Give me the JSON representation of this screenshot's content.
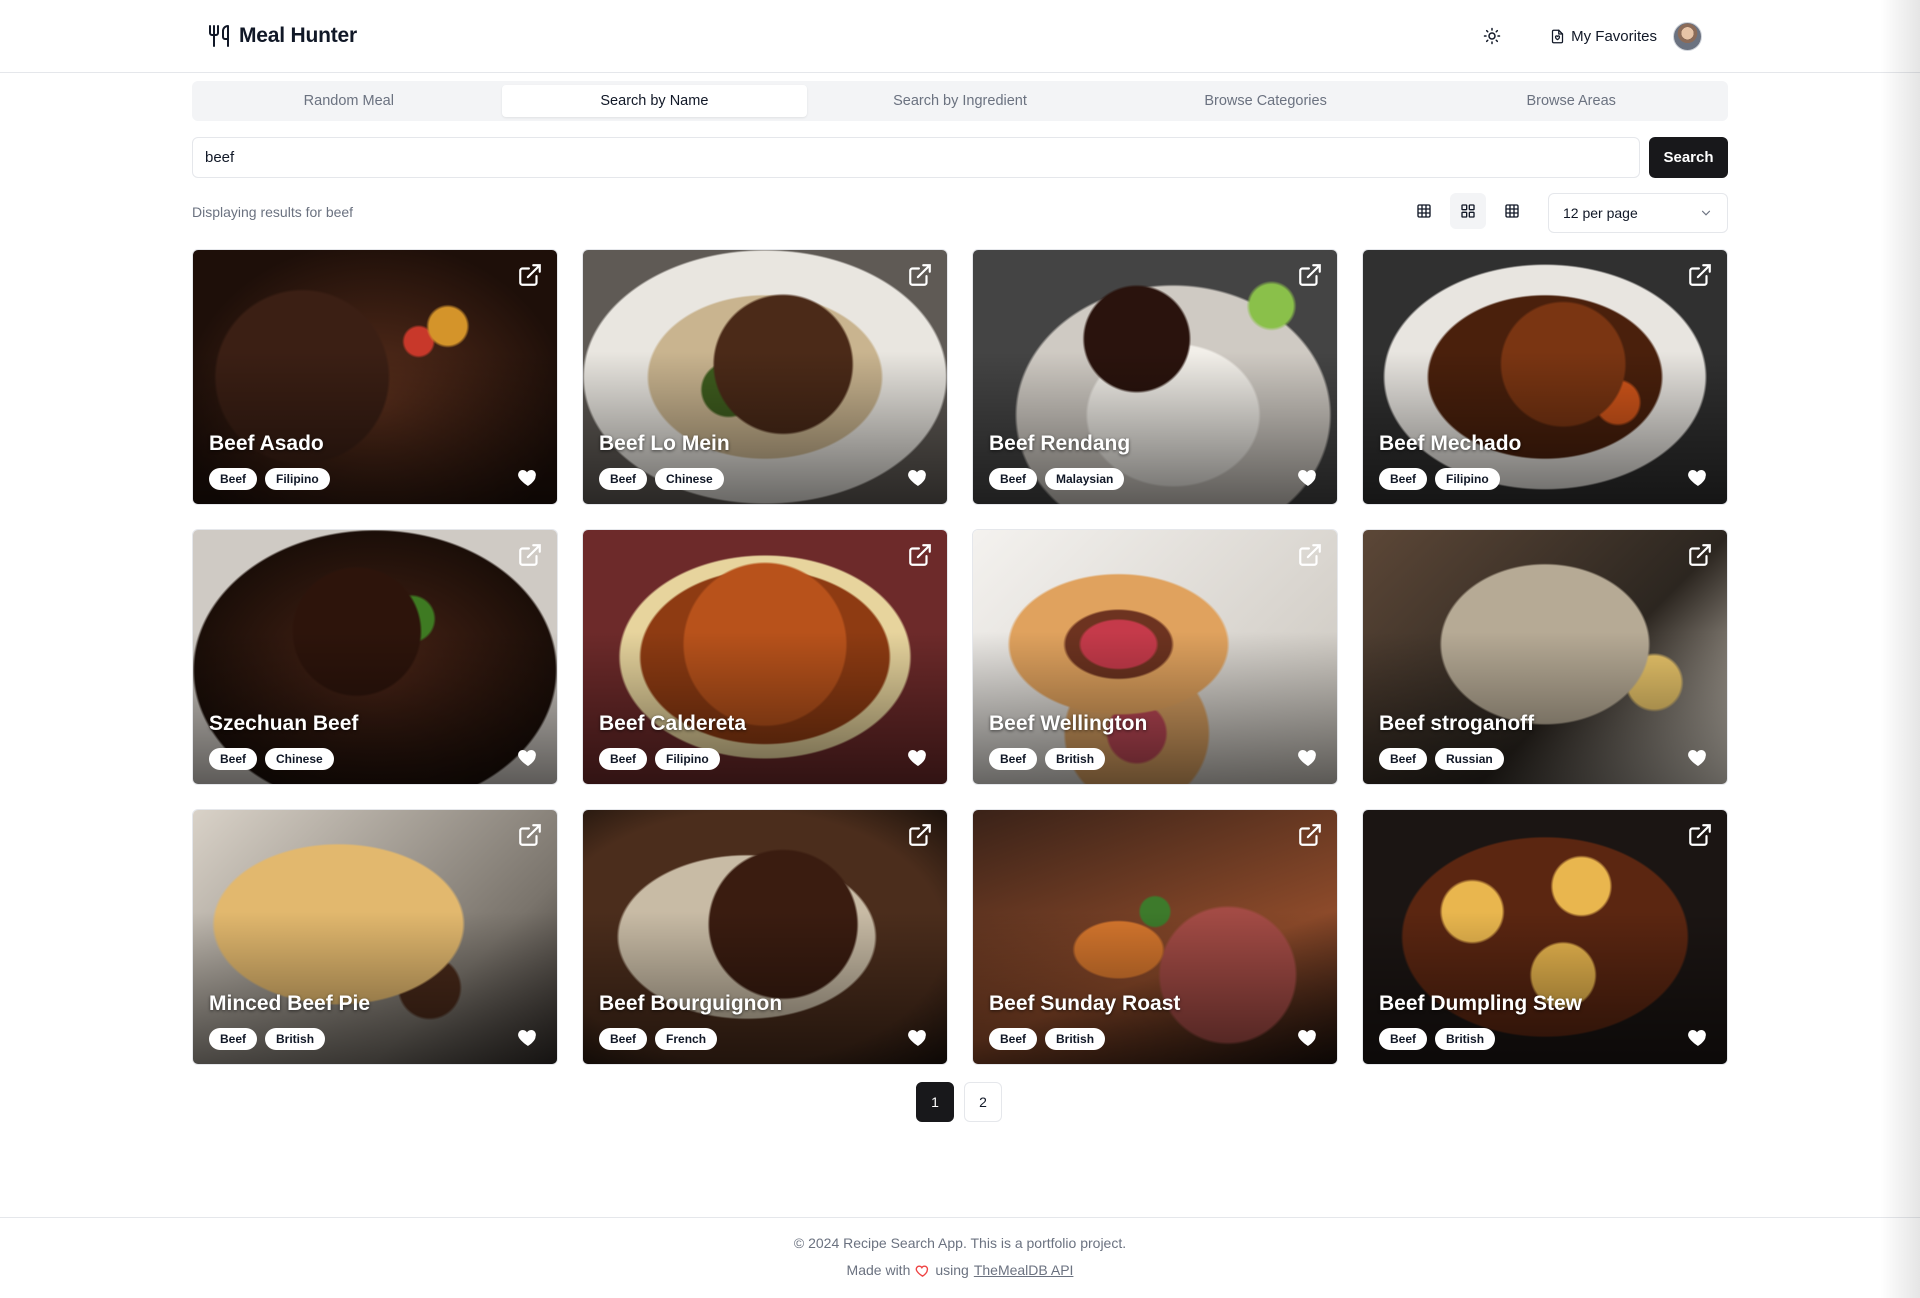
{
  "app": {
    "title": "Meal Hunter",
    "logo_icon": "utensils-icon"
  },
  "header": {
    "favorites_label": "My Favorites",
    "theme_icon": "sun-icon",
    "favorites_icon": "bookmark-heart-icon"
  },
  "tabs": [
    {
      "label": "Random Meal",
      "active": false
    },
    {
      "label": "Search by Name",
      "active": true
    },
    {
      "label": "Search by Ingredient",
      "active": false
    },
    {
      "label": "Browse Categories",
      "active": false
    },
    {
      "label": "Browse Areas",
      "active": false
    }
  ],
  "search": {
    "value": "beef",
    "button_label": "Search"
  },
  "results": {
    "text": "Displaying results for beef",
    "per_page": "12 per page"
  },
  "meals": [
    {
      "name": "Beef Asado",
      "category": "Beef",
      "area": "Filipino"
    },
    {
      "name": "Beef Lo Mein",
      "category": "Beef",
      "area": "Chinese"
    },
    {
      "name": "Beef Rendang",
      "category": "Beef",
      "area": "Malaysian"
    },
    {
      "name": "Beef Mechado",
      "category": "Beef",
      "area": "Filipino"
    },
    {
      "name": "Szechuan Beef",
      "category": "Beef",
      "area": "Chinese"
    },
    {
      "name": "Beef Caldereta",
      "category": "Beef",
      "area": "Filipino"
    },
    {
      "name": "Beef Wellington",
      "category": "Beef",
      "area": "British"
    },
    {
      "name": "Beef stroganoff",
      "category": "Beef",
      "area": "Russian"
    },
    {
      "name": "Minced Beef Pie",
      "category": "Beef",
      "area": "British"
    },
    {
      "name": "Beef Bourguignon",
      "category": "Beef",
      "area": "French"
    },
    {
      "name": "Beef Sunday Roast",
      "category": "Beef",
      "area": "British"
    },
    {
      "name": "Beef Dumpling Stew",
      "category": "Beef",
      "area": "British"
    }
  ],
  "pagination": {
    "pages": [
      "1",
      "2"
    ],
    "current": "1"
  },
  "footer": {
    "line1": "© 2024 Recipe Search App. This is a portfolio project.",
    "made_with": "Made with",
    "using": "using",
    "link": "TheMealDB API"
  },
  "colors": {
    "primary": "#18181b",
    "muted": "#6b7280",
    "border": "#e5e7eb",
    "heart": "#ef4444"
  }
}
